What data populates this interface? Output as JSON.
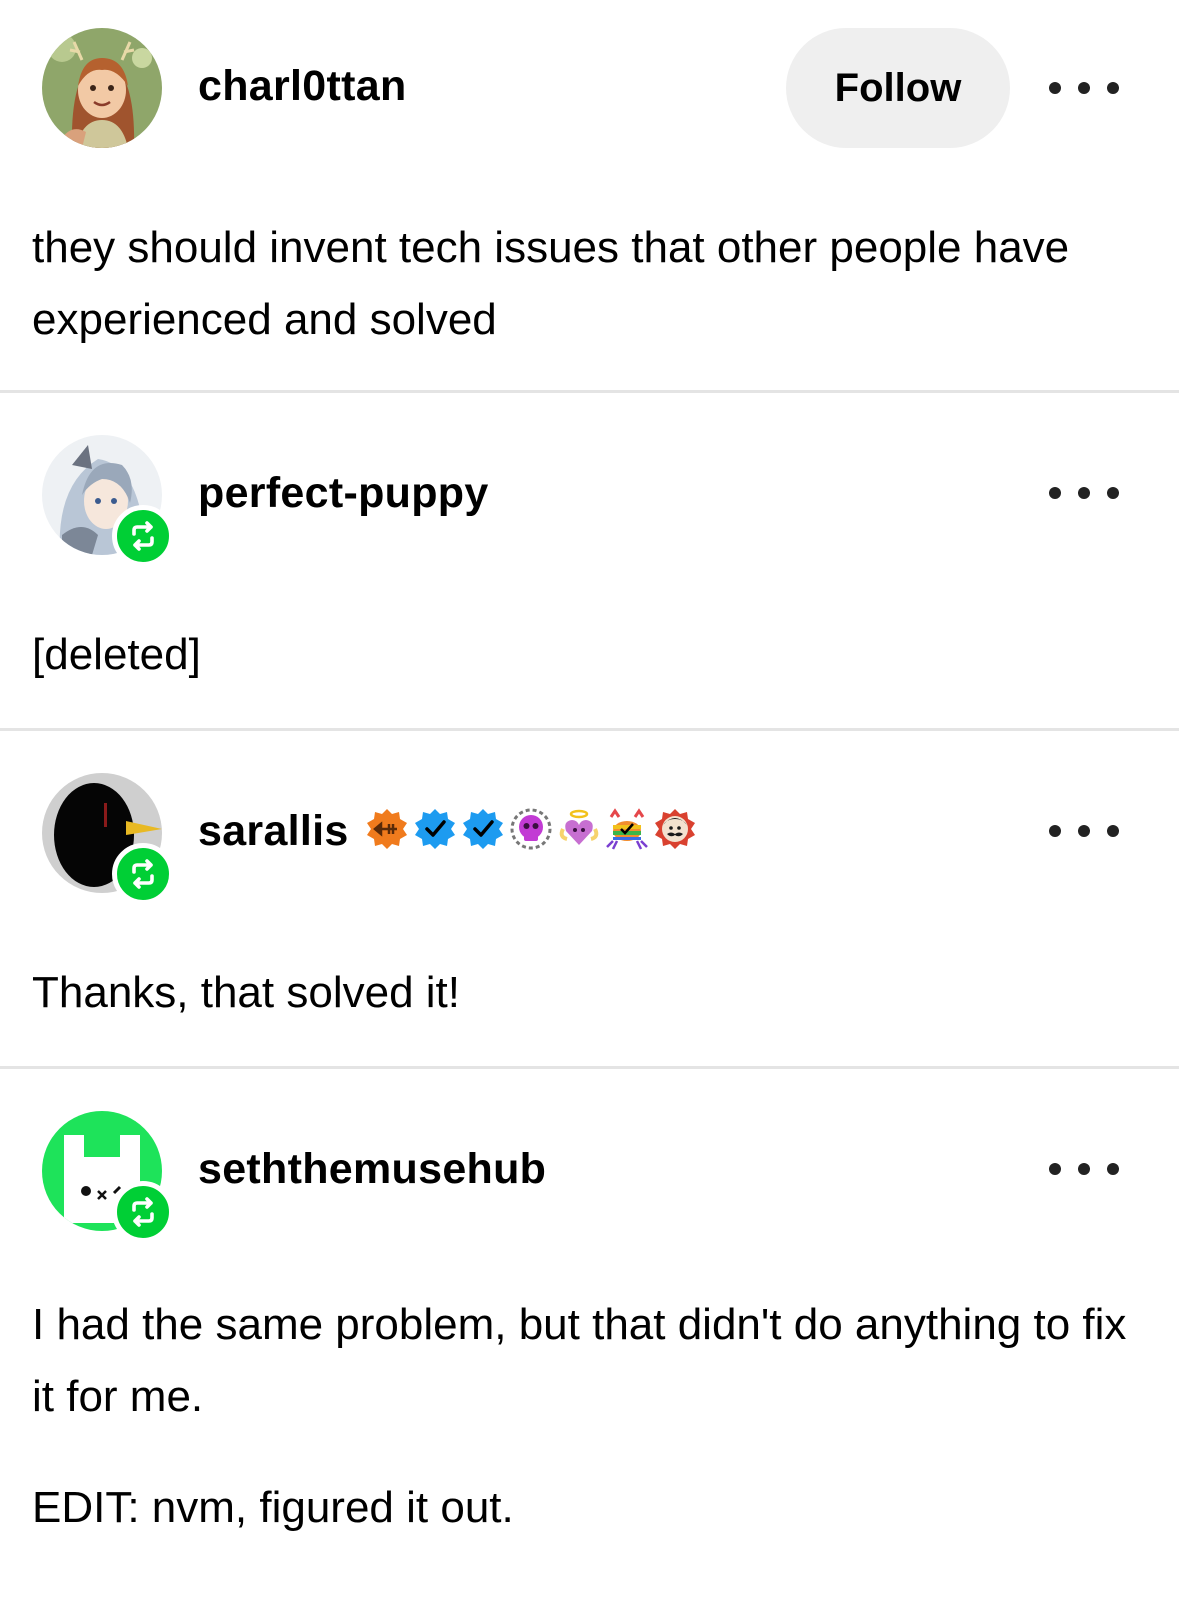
{
  "thread": [
    {
      "username": "charl0ttan",
      "follow_label": "Follow",
      "paragraphs": [
        "they should invent tech issues that other people have experienced and solved"
      ]
    },
    {
      "username": "perfect-puppy",
      "reblog": true,
      "paragraphs": [
        "[deleted]"
      ]
    },
    {
      "username": "sarallis",
      "reblog": true,
      "badges": [
        "orange-fish-badge",
        "blue-check-badge",
        "blue-check-badge",
        "skull-badge",
        "angel-heart-badge",
        "rainbow-crab-badge",
        "mustache-face-badge"
      ],
      "paragraphs": [
        "Thanks, that solved it!"
      ]
    },
    {
      "username": "seththemusehub",
      "reblog": true,
      "paragraphs": [
        "I had the same problem, but that didn't do anything to fix it for me.",
        "EDIT: nvm, figured it out."
      ]
    }
  ],
  "colors": {
    "reblog_green": "#00cf35",
    "follow_bg": "#efefef",
    "divider": "#e4e4e4"
  }
}
